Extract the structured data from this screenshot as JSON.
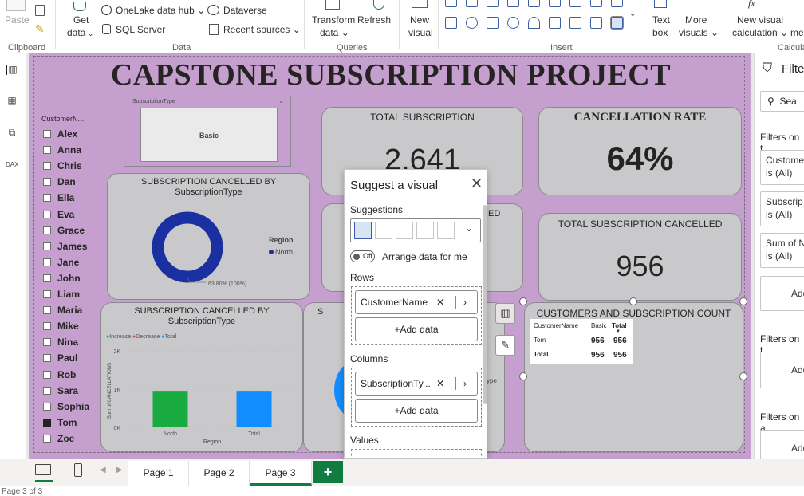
{
  "ribbon": {
    "paste": "Paste",
    "get_data": [
      "Get",
      "data"
    ],
    "onelake": "OneLake data hub",
    "sql_server": "SQL Server",
    "dataverse": "Dataverse",
    "recent_sources": "Recent sources",
    "transform": [
      "Transform",
      "data"
    ],
    "refresh": "Refresh",
    "new_visual": [
      "New",
      "visual"
    ],
    "text_box": [
      "Text",
      "box"
    ],
    "more_visuals": [
      "More",
      "visuals"
    ],
    "new_visual_calc": [
      "New visual",
      "calculation"
    ],
    "measure_partial": [
      "fx",
      "me"
    ],
    "groups": {
      "clipboard": "Clipboard",
      "data": "Data",
      "queries": "Queries",
      "insert": "Insert",
      "calc": "Calcula"
    }
  },
  "report": {
    "title": "CAPSTONE SUBSCRIPTION PROJECT",
    "slicer": {
      "header": "CustomerN...",
      "names": [
        "Alex",
        "Anna",
        "Chris",
        "Dan",
        "Ella",
        "Eva",
        "Grace",
        "James",
        "Jane",
        "John",
        "Liam",
        "Maria",
        "Mike",
        "Nina",
        "Paul",
        "Rob",
        "Sara",
        "Sophia",
        "Tom",
        "Zoe"
      ],
      "selected": "Tom"
    },
    "type_slicer": {
      "label": "SubscriptionType",
      "value": "Basic"
    },
    "total_subscription": {
      "title": "TOTAL SUBSCRIPTION",
      "value": "2,641"
    },
    "cancellation_rate": {
      "title": "CANCELLATION RATE",
      "value": "64%"
    },
    "total_cancelled": {
      "title": "TOTAL SUBSCRIPTION CANCELLED",
      "value": "956"
    },
    "partial_card_text": "ED",
    "donut": {
      "title_line1": "SUBSCRIPTION CANCELLED BY",
      "title_line2": "SubscriptionType",
      "legend_title": "Region",
      "legend_item": "North",
      "label": "63.80% (100%)",
      "color": "#1a2fa0"
    },
    "waterfall": {
      "title_line1": "SUBSCRIPTION CANCELLED BY",
      "title_line2": "SubscriptionType",
      "legend": [
        "Increase",
        "Decrease",
        "Total"
      ],
      "legend_colors": [
        "#1aab40",
        "#d64550",
        "#118dff"
      ],
      "yticks": [
        "2K",
        "1K",
        "0K"
      ],
      "ylabel": "Sum of CANCELLATIONS",
      "categories": [
        "North",
        "Total"
      ],
      "xlabel": "Region"
    },
    "partial_visual": {
      "title_initial": "S",
      "legend_partial": "ype"
    },
    "table": {
      "title": "CUSTOMERS AND SUBSCRIPTION COUNT",
      "columns": [
        "CustomerName",
        "Basic",
        "Total"
      ],
      "rows": [
        [
          "Tom",
          "956",
          "956"
        ]
      ],
      "total_label": "Total",
      "totals": [
        "956",
        "956"
      ]
    }
  },
  "chart_data": {
    "type": "bar",
    "categories": [
      "North",
      "Total"
    ],
    "series": [
      {
        "name": "Increase",
        "values": [
          956,
          null
        ]
      },
      {
        "name": "Total",
        "values": [
          null,
          956
        ]
      }
    ],
    "xlabel": "Region",
    "ylabel": "Sum of CANCELLATIONS",
    "ylim": [
      0,
      2000
    ],
    "yticks": [
      "0K",
      "1K",
      "2K"
    ],
    "colors": [
      "#1aab40",
      "#118dff"
    ],
    "legend": "top-left"
  },
  "popup": {
    "title": "Suggest a visual",
    "suggestions": "Suggestions",
    "toggle": "Off",
    "arrange": "Arrange data for me",
    "rows": "Rows",
    "row_field": "CustomerName",
    "add_data": "+Add data",
    "columns": "Columns",
    "col_field": "SubscriptionTy...",
    "values": "Values"
  },
  "filters": {
    "title": "Filte",
    "search": "Sea",
    "on_this": "Filters on t",
    "items": [
      [
        "Custome",
        "is (All)"
      ],
      [
        "Subscrip",
        "is (All)"
      ],
      [
        "Sum of N",
        "is (All)"
      ]
    ],
    "add": "Add",
    "on_page": "Filters on t",
    "on_all": "Filters on a"
  },
  "tabs": [
    "Page 1",
    "Page 2",
    "Page 3"
  ],
  "active_tab": "Page 3",
  "status": "Page 3 of 3"
}
